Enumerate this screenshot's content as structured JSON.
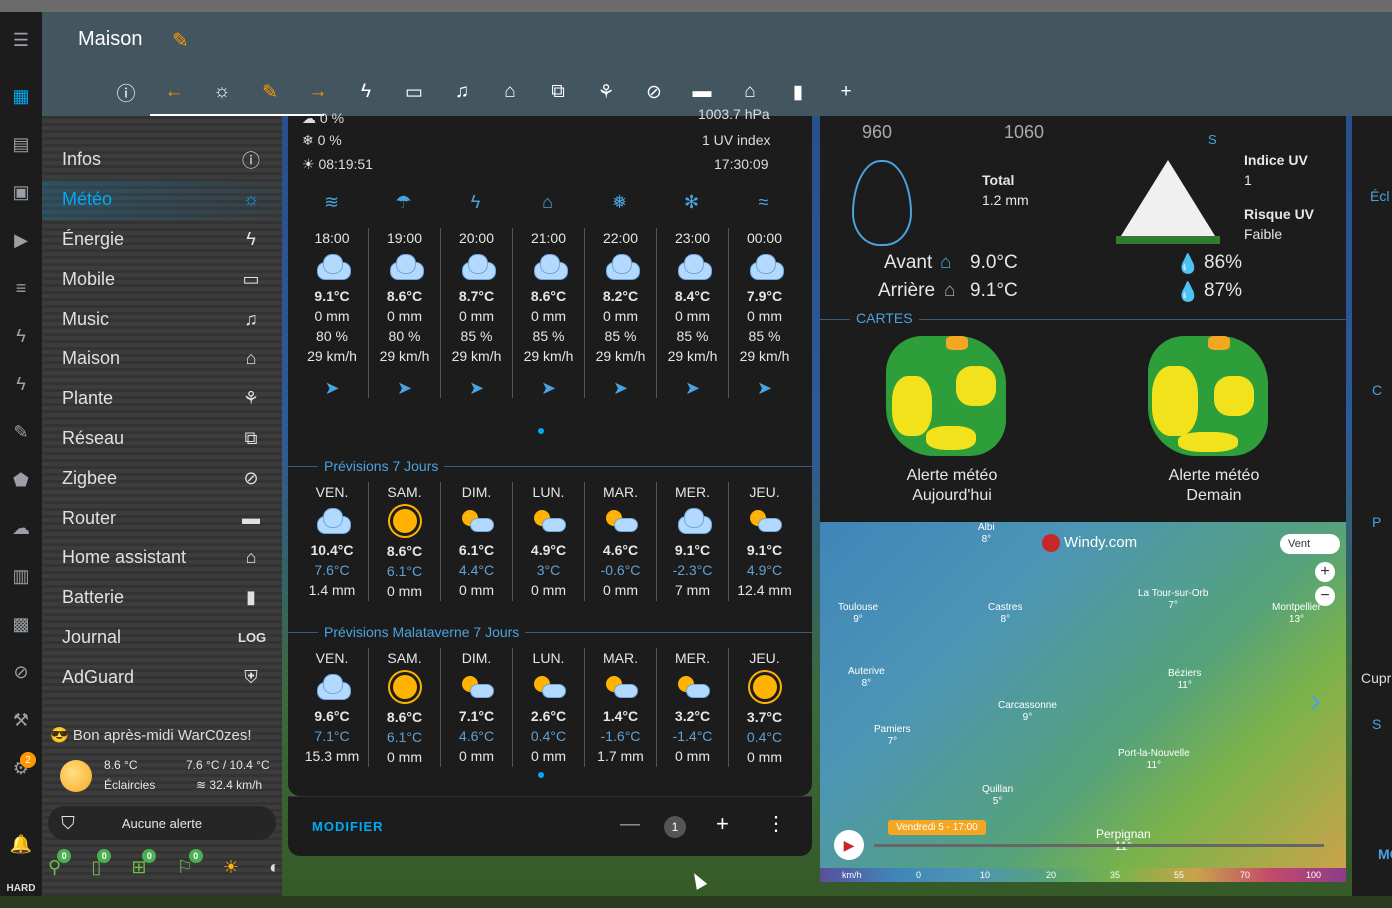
{
  "app": {
    "title": "Maison"
  },
  "rail": {
    "badge": "2"
  },
  "tabs": [
    "info",
    "back",
    "weather",
    "edit",
    "forward",
    "bolt",
    "devices",
    "music",
    "home",
    "network",
    "plant",
    "zigbee",
    "router",
    "home-assistant",
    "battery",
    "add"
  ],
  "sidebar": {
    "items": [
      {
        "label": "Infos",
        "icon": "info-icon"
      },
      {
        "label": "Météo",
        "icon": "weather-icon"
      },
      {
        "label": "Énergie",
        "icon": "bolt-icon"
      },
      {
        "label": "Mobile",
        "icon": "devices-icon"
      },
      {
        "label": "Music",
        "icon": "music-icon"
      },
      {
        "label": "Maison",
        "icon": "home-icon"
      },
      {
        "label": "Plante",
        "icon": "plant-icon"
      },
      {
        "label": "Réseau",
        "icon": "network-icon"
      },
      {
        "label": "Zigbee",
        "icon": "zigbee-icon"
      },
      {
        "label": "Router",
        "icon": "router-icon"
      },
      {
        "label": "Home assistant",
        "icon": "home-assistant-icon"
      },
      {
        "label": "Batterie",
        "icon": "battery-icon"
      },
      {
        "label": "Journal",
        "icon": "log-icon"
      },
      {
        "label": "AdGuard",
        "icon": "shield-icon"
      }
    ],
    "journal_icon_text": "LOG",
    "greeting": "Bon après-midi WarC0zes!",
    "weather": {
      "temp": "8.6 °C",
      "cond": "Éclaircies",
      "range": "7.6 °C / 10.4 °C",
      "wind": "32.4 km/h"
    },
    "alert": "Aucune alerte",
    "counts": [
      "0",
      "0",
      "0",
      "0"
    ]
  },
  "weather_card": {
    "top": {
      "p1": "0 %",
      "p2": "0 %",
      "sunrise": "08:19:51",
      "pressure": "1003.7 hPa",
      "uv": "1 UV index",
      "sunset": "17:30:09"
    },
    "hourly": [
      {
        "time": "18:00",
        "temp": "9.1°C",
        "rain": "0 mm",
        "hum": "80 %",
        "wind": "29 km/h"
      },
      {
        "time": "19:00",
        "temp": "8.6°C",
        "rain": "0 mm",
        "hum": "80 %",
        "wind": "29 km/h"
      },
      {
        "time": "20:00",
        "temp": "8.7°C",
        "rain": "0 mm",
        "hum": "85 %",
        "wind": "29 km/h"
      },
      {
        "time": "21:00",
        "temp": "8.6°C",
        "rain": "0 mm",
        "hum": "85 %",
        "wind": "29 km/h"
      },
      {
        "time": "22:00",
        "temp": "8.2°C",
        "rain": "0 mm",
        "hum": "85 %",
        "wind": "29 km/h"
      },
      {
        "time": "23:00",
        "temp": "8.4°C",
        "rain": "0 mm",
        "hum": "85 %",
        "wind": "29 km/h"
      },
      {
        "time": "00:00",
        "temp": "7.9°C",
        "rain": "0 mm",
        "hum": "85 %",
        "wind": "29 km/h"
      }
    ],
    "section1": "Prévisions 7 Jours",
    "daily": [
      {
        "day": "VEN.",
        "hi": "10.4°C",
        "lo": "7.6°C",
        "rain": "1.4 mm",
        "icon": "cloud"
      },
      {
        "day": "SAM.",
        "hi": "8.6°C",
        "lo": "6.1°C",
        "rain": "0 mm",
        "icon": "sun"
      },
      {
        "day": "DIM.",
        "hi": "6.1°C",
        "lo": "4.4°C",
        "rain": "0 mm",
        "icon": "partly"
      },
      {
        "day": "LUN.",
        "hi": "4.9°C",
        "lo": "3°C",
        "rain": "0 mm",
        "icon": "partly"
      },
      {
        "day": "MAR.",
        "hi": "4.6°C",
        "lo": "-0.6°C",
        "rain": "0 mm",
        "icon": "partly"
      },
      {
        "day": "MER.",
        "hi": "9.1°C",
        "lo": "-2.3°C",
        "rain": "7 mm",
        "icon": "cloud"
      },
      {
        "day": "JEU.",
        "hi": "9.1°C",
        "lo": "4.9°C",
        "rain": "12.4 mm",
        "icon": "partly"
      }
    ],
    "section2": "Prévisions Malataverne 7 Jours",
    "daily2": [
      {
        "day": "VEN.",
        "hi": "9.6°C",
        "lo": "7.1°C",
        "rain": "15.3 mm",
        "icon": "cloud"
      },
      {
        "day": "SAM.",
        "hi": "8.6°C",
        "lo": "6.1°C",
        "rain": "0 mm",
        "icon": "sun"
      },
      {
        "day": "DIM.",
        "hi": "7.1°C",
        "lo": "4.6°C",
        "rain": "0 mm",
        "icon": "partly"
      },
      {
        "day": "LUN.",
        "hi": "2.6°C",
        "lo": "0.4°C",
        "rain": "0 mm",
        "icon": "partly"
      },
      {
        "day": "MAR.",
        "hi": "1.4°C",
        "lo": "-1.6°C",
        "rain": "1.7 mm",
        "icon": "partly"
      },
      {
        "day": "MER.",
        "hi": "3.2°C",
        "lo": "-1.4°C",
        "rain": "0 mm",
        "icon": "partly"
      },
      {
        "day": "JEU.",
        "hi": "3.7°C",
        "lo": "0.4°C",
        "rain": "0 mm",
        "icon": "sun"
      }
    ],
    "footer": {
      "modify": "MODIFIER",
      "page": "1"
    }
  },
  "right_card": {
    "p960": "960",
    "p1060": "1060",
    "compass": "S",
    "total_label": "Total",
    "total_value": "1.2 mm",
    "uv_label": "Indice UV",
    "uv_value": "1",
    "risk_label": "Risque UV",
    "risk_value": "Faible",
    "front_label": "Avant",
    "front_temp": "9.0°C",
    "front_hum": "86%",
    "back_label": "Arrière",
    "back_temp": "9.1°C",
    "back_hum": "87%",
    "cartes": "CARTES",
    "map1": "Alerte météo\nAujourd'hui",
    "map1a": "Alerte météo",
    "map1b": "Aujourd'hui",
    "map2a": "Alerte météo",
    "map2b": "Demain"
  },
  "windy": {
    "logo": "Windy.com",
    "vent": "Vent",
    "date": "Vendredi 5 - 17:00",
    "cities": [
      {
        "n": "Albi",
        "t": "8°"
      },
      {
        "n": "Toulouse",
        "t": "9°"
      },
      {
        "n": "Castres",
        "t": "8°"
      },
      {
        "n": "La Tour-sur-Orb",
        "t": "7°"
      },
      {
        "n": "Montpellier",
        "t": "13°"
      },
      {
        "n": "Auterive",
        "t": "8°"
      },
      {
        "n": "Béziers",
        "t": "11°"
      },
      {
        "n": "Carcassonne",
        "t": "9°"
      },
      {
        "n": "Pamiers",
        "t": "7°"
      },
      {
        "n": "Port-la-Nouvelle",
        "t": "11°"
      },
      {
        "n": "Quillan",
        "t": "5°"
      },
      {
        "n": "Perpignan",
        "t": "11°"
      }
    ],
    "scale": [
      "km/h",
      "0",
      "10",
      "20",
      "35",
      "55",
      "70",
      "100"
    ]
  },
  "far": {
    "t1": "Écl",
    "t2": "C",
    "t3": "P",
    "t4": "Cupro",
    "t5": "S",
    "t6": "MO"
  }
}
